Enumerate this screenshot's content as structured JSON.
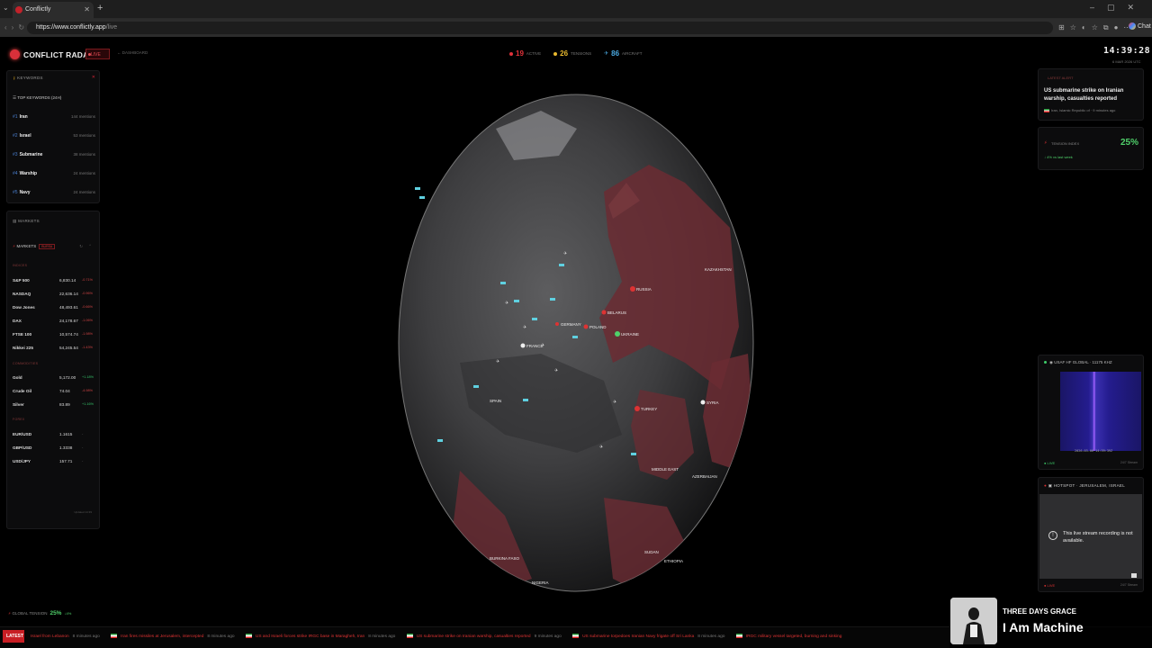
{
  "browser": {
    "tab_title": "Conflictly",
    "url_host": "https://www.conflictly.app",
    "url_path": "/live",
    "chat_label": "Chat"
  },
  "header": {
    "brand": "CONFLICT RADAR",
    "live_badge": "LIVE",
    "dashboard_link": "DASHBOARD",
    "stats": [
      {
        "value": "19",
        "label": "ACTIVE",
        "color": "#e0323a"
      },
      {
        "value": "26",
        "label": "TENSIONS",
        "color": "#e8b92e"
      },
      {
        "value": "86",
        "label": "AIRCRAFT",
        "color": "#4aa8e0"
      }
    ],
    "clock": "14:39:28",
    "clock_date": "6 MAR 2026 UTC"
  },
  "keywords": {
    "panel_title": "KEYWORDS",
    "subtitle": "TOP KEYWORDS (24H)",
    "items": [
      {
        "rank": "#1",
        "name": "Iran",
        "count": "144 mentions"
      },
      {
        "rank": "#2",
        "name": "Israel",
        "count": "53 mentions"
      },
      {
        "rank": "#3",
        "name": "Submarine",
        "count": "38 mentions"
      },
      {
        "rank": "#4",
        "name": "Warship",
        "count": "24 mentions"
      },
      {
        "rank": "#5",
        "name": "Navy",
        "count": "24 mentions"
      }
    ]
  },
  "markets": {
    "panel_title": "MARKETS",
    "inner_title": "MARKETS",
    "badge": "BURSA",
    "groups": [
      {
        "name": "INDICES",
        "rows": [
          {
            "name": "S&P 500",
            "value": "6,830.14",
            "change": "-0.71%",
            "dir": "neg"
          },
          {
            "name": "NASDAQ",
            "value": "22,636.14",
            "change": "-0.96%",
            "dir": "neg"
          },
          {
            "name": "Dow Jones",
            "value": "48,493.61",
            "change": "-0.66%",
            "dir": "neg"
          },
          {
            "name": "DAX",
            "value": "24,178.67",
            "change": "-1.06%",
            "dir": "neg"
          },
          {
            "name": "FTSE 100",
            "value": "10,574.74",
            "change": "-1.98%",
            "dir": "neg"
          },
          {
            "name": "Nikkei 225",
            "value": "54,245.54",
            "change": "-1.43%",
            "dir": "neg"
          }
        ]
      },
      {
        "name": "COMMODITIES",
        "rows": [
          {
            "name": "Gold",
            "value": "5,172.00",
            "change": "+1.18%",
            "dir": "pos"
          },
          {
            "name": "Crude Oil",
            "value": "74.04",
            "change": "-4.98%",
            "dir": "neg"
          },
          {
            "name": "Silver",
            "value": "83.89",
            "change": "+1.16%",
            "dir": "pos"
          }
        ]
      },
      {
        "name": "FOREX",
        "rows": [
          {
            "name": "EUR/USD",
            "value": "1.1615",
            "change": "-",
            "dir": "neu"
          },
          {
            "name": "GBP/USD",
            "value": "1.3338",
            "change": "-",
            "dir": "neu"
          },
          {
            "name": "USD/JPY",
            "value": "157.71",
            "change": "-",
            "dir": "neu"
          }
        ]
      }
    ],
    "updated": "Updated 14:39"
  },
  "alert": {
    "label": "LATEST ALERT",
    "title": "US submarine strike on Iranian warship, casualties reported",
    "country": "Iran, Islamic Republic of",
    "time": "9 minutes ago"
  },
  "tension_index": {
    "label": "TENSION INDEX",
    "value": "25%",
    "change": "↓ 4% vs last week"
  },
  "radio": {
    "title": "USAF HF GLOBAL · 11175 KHZ",
    "timestamp": "2026-03-06 14:39:39Z",
    "live": "● LIVE",
    "tag": "24/7 Stream"
  },
  "hotspot": {
    "title": "HOTSPOT · JERUSALEM, ISRAEL",
    "message": "This live stream recording is not available.",
    "live": "● LIVE",
    "tag": "24/7 Stream"
  },
  "global_tension": {
    "label": "GLOBAL TENSION",
    "value": "25%",
    "arrow": "↓4%"
  },
  "ticker": {
    "label": "LATEST",
    "items": [
      {
        "text": "Israel from Lebanon",
        "time": "8 minutes ago"
      },
      {
        "text": "Iran fires missiles at Jerusalem, intercepted",
        "time": "8 minutes ago"
      },
      {
        "text": "US and Israeli forces strike IRGC base in Maragheh, Iran",
        "time": "8 minutes ago"
      },
      {
        "text": "US submarine strike on Iranian warship, casualties reported",
        "time": "9 minutes ago"
      },
      {
        "text": "US submarine torpedoes Iranian Navy frigate off Sri Lanka",
        "time": "8 minutes ago"
      },
      {
        "text": "IRGC military vessel targeted, burning and sinking",
        "time": ""
      }
    ]
  },
  "map_labels": [
    {
      "text": "RUSSIA"
    },
    {
      "text": "BELARUS"
    },
    {
      "text": "UKRAINE"
    },
    {
      "text": "POLAND"
    },
    {
      "text": "GERMANY"
    },
    {
      "text": "TURKEY"
    },
    {
      "text": "SYRIA"
    },
    {
      "text": "MIDDLE EAST"
    },
    {
      "text": "FRANCE"
    },
    {
      "text": "SPAIN"
    },
    {
      "text": "SUDAN"
    },
    {
      "text": "ETHIOPIA"
    },
    {
      "text": "BURKINA FASO"
    },
    {
      "text": "NIGERIA"
    },
    {
      "text": "AZERBAIJAN"
    },
    {
      "text": "KAZAKHSTAN"
    }
  ],
  "now_playing": {
    "artist": "THREE DAYS GRACE",
    "song": "I Am Machine"
  }
}
